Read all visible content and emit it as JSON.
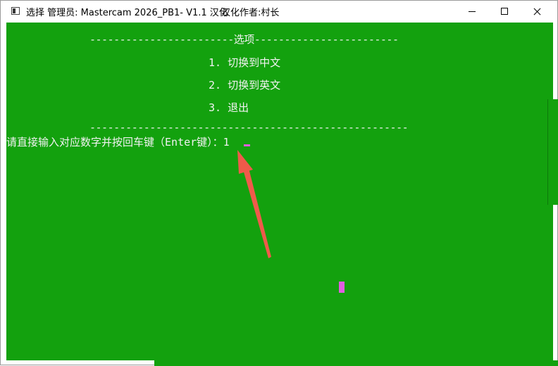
{
  "window": {
    "title": "选择 管理员:  Mastercam 2026_PB1- V1.1 汉化",
    "author": "汉化作者:村长"
  },
  "console": {
    "header_line": "------------------------选项------------------------",
    "options": [
      "1. 切换到中文",
      "2. 切换到英文",
      "3. 退出"
    ],
    "footer_line": "-----------------------------------------------------",
    "prompt": "请直接输入对应数字并按回车键（Enter键）：1"
  },
  "colors": {
    "console_bg": "#13a10e",
    "console_text": "#f2f2f2",
    "cursor": "#e05ee0",
    "arrow": "#f05a4a"
  },
  "icons": {
    "app": "console-app-icon",
    "minimize": "minimize-icon",
    "maximize": "maximize-icon",
    "close": "close-icon",
    "annotation": "red-arrow-icon"
  }
}
